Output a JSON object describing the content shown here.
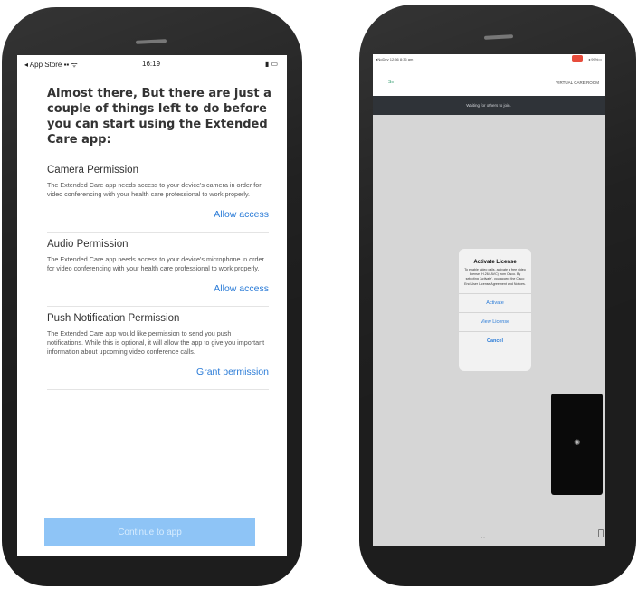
{
  "left_screen": {
    "status": {
      "carrier": "◂ App Store ▪▪ ᯤ",
      "time": "16:19",
      "battery": "▮ ▭"
    },
    "intro": "Almost there, But there are just a couple of things left to do before you can start using the Extended Care app:",
    "permissions": [
      {
        "title": "Camera Permission",
        "description": "The Extended Care app needs access to your device's camera in order for video conferencing with your health care professional to work properly.",
        "action": "Allow access"
      },
      {
        "title": "Audio Permission",
        "description": "The Extended Care app needs access to your device's microphone in order for video conferencing with your health care professional to work properly.",
        "action": "Allow access"
      },
      {
        "title": "Push Notification Permission",
        "description": "The Extended Care app would like permission to send you push notifications. While this is optional, it will allow the app to give you important information about upcoming video conference calls.",
        "action": "Grant permission"
      }
    ],
    "continue_label": "Continue to app"
  },
  "right_screen": {
    "status": {
      "left": "●NoDev 12:56 8:36 am",
      "right": "◂ 99%▭"
    },
    "header_title": "VIRTUAL CARE ROOM",
    "banner": "Waiting for others to join.",
    "dialog": {
      "title": "Activate License",
      "message": "To enable video calls, activate a free video license (H.264 AVC) from Cisco. By selecting 'Activate', you accept the Cisco End User License Agreement and Notices.",
      "buttons": [
        "Activate",
        "View License",
        "Cancel"
      ]
    }
  },
  "colors": {
    "accent": "#2a7bd7",
    "continue_bg": "#8ec4f6",
    "banner_bg": "#2f3338",
    "phone_body": "#1d1d1d"
  }
}
